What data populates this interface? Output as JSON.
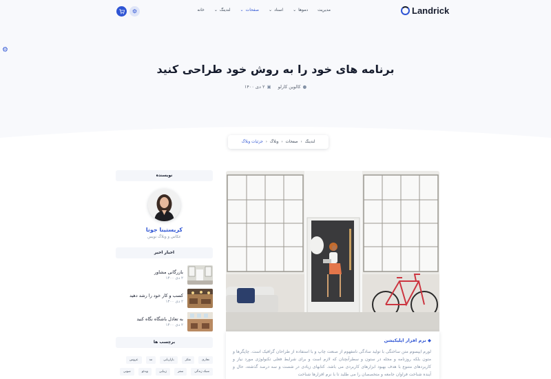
{
  "brand": {
    "name": "Landrick"
  },
  "nav": {
    "items": [
      {
        "label": "خانه",
        "dropdown": false,
        "active": false
      },
      {
        "label": "لندینگ",
        "dropdown": true,
        "active": false
      },
      {
        "label": "صفحات",
        "dropdown": true,
        "active": true
      },
      {
        "label": "اسناد",
        "dropdown": true,
        "active": false
      },
      {
        "label": "دموها",
        "dropdown": true,
        "active": false
      },
      {
        "label": "مدیریت",
        "dropdown": false,
        "active": false
      }
    ],
    "cart_icon": "cart-icon",
    "settings_icon": "gear-icon"
  },
  "hero": {
    "title": "برنامه های خود را به روش خود طراحی کنید",
    "author": "کالوین کارلو",
    "date": "۲ دی ۱۴۰۰"
  },
  "breadcrumb": [
    "لندینگ",
    "صفحات",
    "وبلاگ",
    "جزئیات وبلاگ"
  ],
  "sidebar": {
    "author_heading": "نویسنده",
    "author_name": "کریستینا جوتا",
    "author_role": "عکاس و وبلاگ نویس",
    "recent_heading": "اخبار اخیر",
    "recent": [
      {
        "title": "بازرگانی مشاور",
        "date": "۲ دی ۱۴۰۰"
      },
      {
        "title": "کسب و کار خود را رشد دهید",
        "date": "۲ دی ۱۴۰۰"
      },
      {
        "title": "به تعادل باشگاه نگاه کنید",
        "date": "۲ دی ۱۴۰۰"
      }
    ],
    "tags_heading": "برچسب ها",
    "tags": [
      "تجاری",
      "تفکر",
      "بازاریابی",
      "مد",
      "عروس",
      "سبک زندگی",
      "سفر",
      "زیبایی",
      "ویدئو",
      "صوتی"
    ]
  },
  "article": {
    "category": "نرم افزار اپلیکیشن",
    "category_icon": "tag-icon",
    "text": "لورم ایپسوم متن ساختگی با تولید سادگی نامفهوم از صنعت چاپ و با استفاده از طراحان گرافیک است. چاپگرها و متون بلکه روزنامه و مجله در ستون و سطرآنچنان که لازم است و برای شرایط فعلی تکنولوژی مورد نیاز و کاربردهای متنوع با هدف بهبود ابزارهای کاربردی می باشد. کتابهای زیادی در شصت و سه درصد گذشته، حال و آینده شناخت فراوان جامعه و متخصصان را می طلبد تا با نرم افزارها شناخت"
  },
  "colors": {
    "primary": "#2f55d4",
    "dark": "#161c2d",
    "muted": "#8492a6",
    "hero_bg": "#f8f9fc"
  }
}
